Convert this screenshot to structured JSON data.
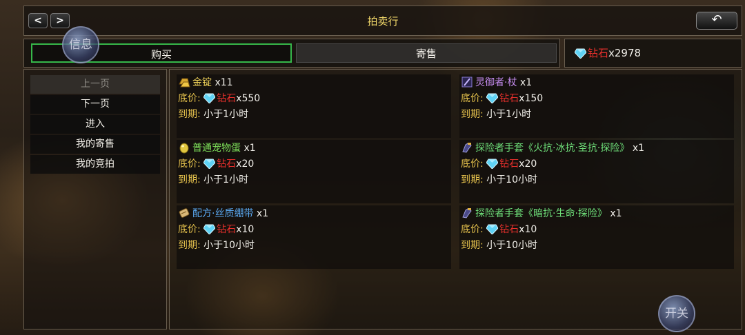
{
  "header": {
    "title": "拍卖行",
    "prev_label": "<",
    "next_label": ">",
    "back_label": "↶"
  },
  "tabs": {
    "buy": "购买",
    "sell": "寄售"
  },
  "currency": {
    "name": "钻石",
    "amount": "x2978"
  },
  "sidebar": {
    "items": [
      {
        "label": "上一页",
        "disabled": true
      },
      {
        "label": "下一页"
      },
      {
        "label": "进入"
      },
      {
        "label": "我的寄售"
      },
      {
        "label": "我的竞拍"
      }
    ]
  },
  "labels": {
    "price": "底价:",
    "expire": "到期:"
  },
  "listings": [
    {
      "name": "金锭",
      "qty": "x11",
      "name_color": "#f0d35a",
      "icon": "gold-ingot-icon",
      "price_currency": "钻石",
      "price_amount": "x550",
      "expire": "小于1小时"
    },
    {
      "name": "灵御者·杖",
      "qty": "x1",
      "name_color": "#c58cf0",
      "icon": "staff-icon",
      "price_currency": "钻石",
      "price_amount": "x150",
      "expire": "小于1小时"
    },
    {
      "name": "普通宠物蛋",
      "qty": "x1",
      "name_color": "#7ee05a",
      "icon": "pet-egg-icon",
      "price_currency": "钻石",
      "price_amount": "x20",
      "expire": "小于1小时"
    },
    {
      "name": "探险者手套《火抗·冰抗·圣抗·探险》",
      "qty": "x1",
      "name_color": "#6fe07a",
      "icon": "gloves-icon",
      "price_currency": "钻石",
      "price_amount": "x20",
      "expire": "小于10小时"
    },
    {
      "name": "配方·丝质绷带",
      "qty": "x1",
      "name_color": "#5aa8f0",
      "icon": "scroll-icon",
      "price_currency": "钻石",
      "price_amount": "x10",
      "expire": "小于10小时"
    },
    {
      "name": "探险者手套《暗抗·生命·探险》",
      "qty": "x1",
      "name_color": "#6fe07a",
      "icon": "gloves-icon",
      "price_currency": "钻石",
      "price_amount": "x10",
      "expire": "小于10小时"
    }
  ],
  "floating": {
    "info_label": "信息",
    "toggle_label": "开关"
  }
}
